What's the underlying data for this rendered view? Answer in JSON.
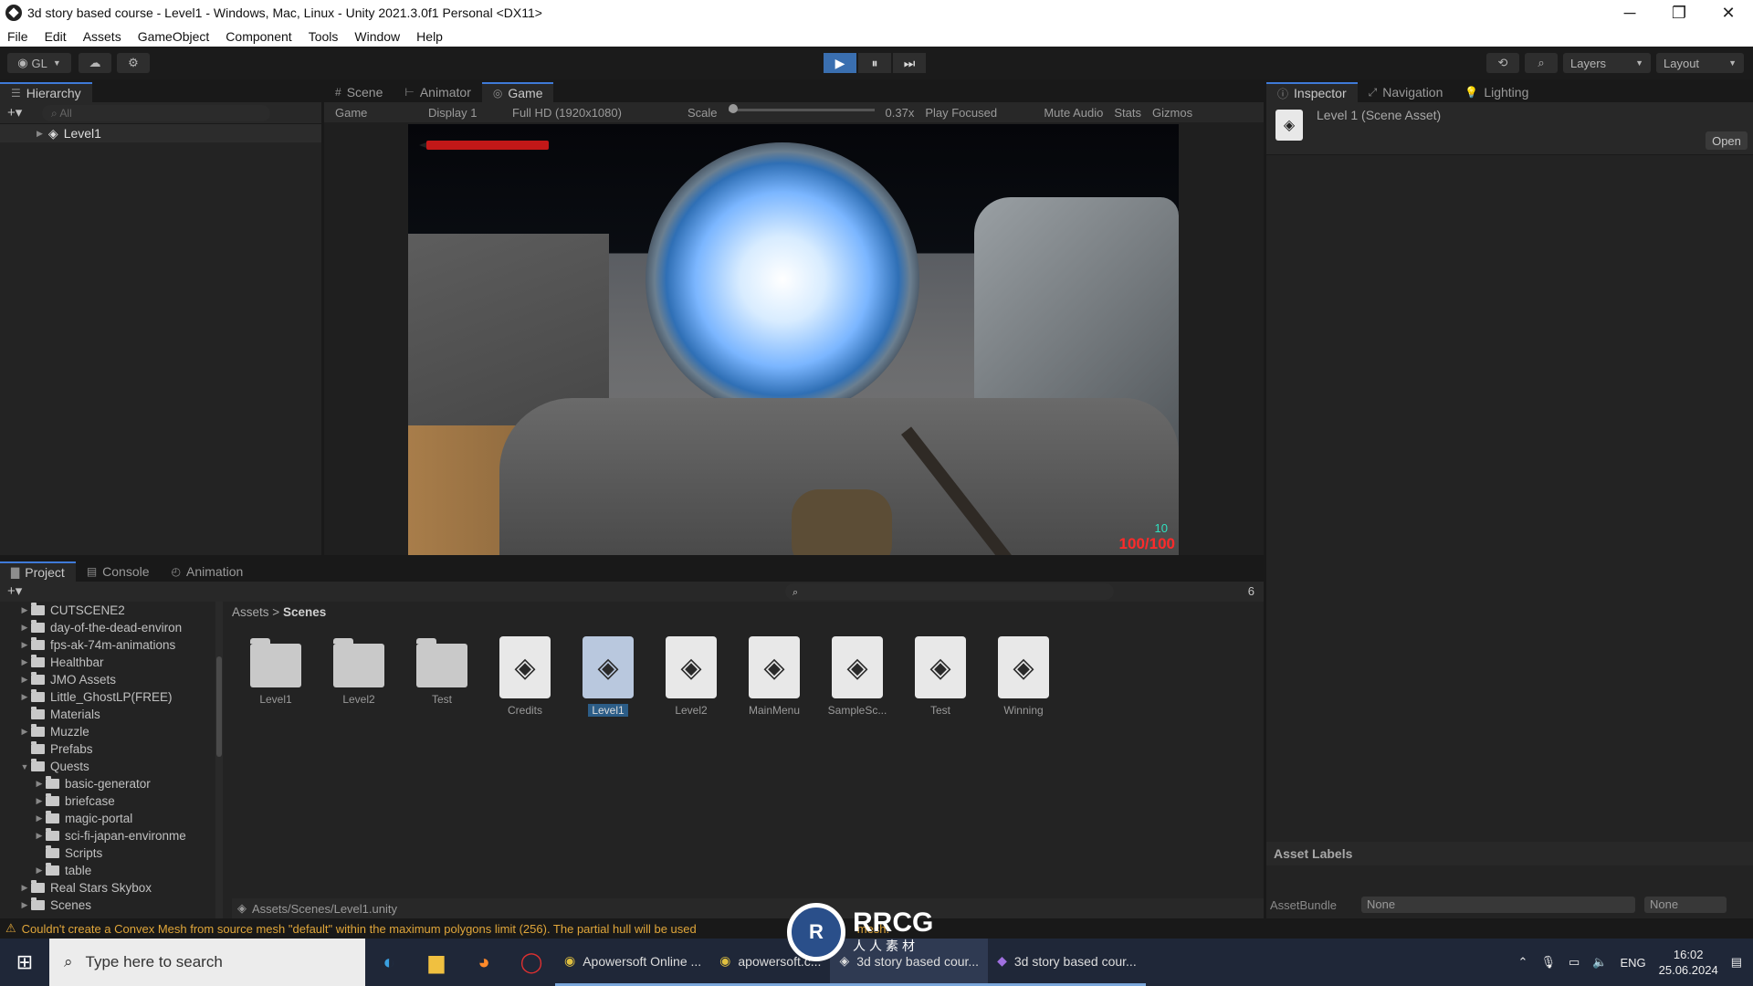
{
  "window": {
    "title": "3d story based course - Level1 - Windows, Mac, Linux - Unity 2021.3.0f1 Personal <DX11>",
    "minimize": "─",
    "restore": "❐",
    "close": "✕"
  },
  "menu": [
    "File",
    "Edit",
    "Assets",
    "GameObject",
    "Component",
    "Tools",
    "Window",
    "Help"
  ],
  "toolbar": {
    "account": "GL",
    "layers": "Layers",
    "layout": "Layout",
    "play": "▶",
    "pause": "⏸",
    "step": "⏭"
  },
  "hierarchy": {
    "tab": "Hierarchy",
    "search_placeholder": "All",
    "root": "Level1"
  },
  "gameview": {
    "tabs": [
      "Scene",
      "Animator",
      "Game"
    ],
    "toolbar": {
      "mode": "Game",
      "display": "Display 1",
      "resolution": "Full HD (1920x1080)",
      "scale_label": "Scale",
      "scale_value": "0.37x",
      "play_focused": "Play Focused",
      "mute": "Mute Audio",
      "stats": "Stats",
      "gizmos": "Gizmos"
    },
    "hud": {
      "ammo_clip": "10",
      "ammo_total": "100/100"
    }
  },
  "inspector": {
    "tabs": [
      "Inspector",
      "Navigation",
      "Lighting"
    ],
    "asset_title": "Level 1 (Scene Asset)",
    "open_button": "Open",
    "asset_labels": "Asset Labels",
    "asset_bundle_label": "AssetBundle",
    "asset_bundle_value": "None",
    "asset_variant_value": "None"
  },
  "project": {
    "tabs": [
      "Project",
      "Console",
      "Animation"
    ],
    "tree": [
      {
        "label": "CUTSCENE2",
        "indent": 0,
        "arrow": "▶",
        "open": false
      },
      {
        "label": "day-of-the-dead-environ",
        "indent": 0,
        "arrow": "▶",
        "open": false
      },
      {
        "label": "fps-ak-74m-animations",
        "indent": 0,
        "arrow": "▶",
        "open": false
      },
      {
        "label": "Healthbar",
        "indent": 0,
        "arrow": "▶",
        "open": false
      },
      {
        "label": "JMO Assets",
        "indent": 0,
        "arrow": "▶",
        "open": false
      },
      {
        "label": "Little_GhostLP(FREE)",
        "indent": 0,
        "arrow": "▶",
        "open": false
      },
      {
        "label": "Materials",
        "indent": 0,
        "arrow": "",
        "open": false
      },
      {
        "label": "Muzzle",
        "indent": 0,
        "arrow": "▶",
        "open": false
      },
      {
        "label": "Prefabs",
        "indent": 0,
        "arrow": "",
        "open": false
      },
      {
        "label": "Quests",
        "indent": 0,
        "arrow": "▼",
        "open": true
      },
      {
        "label": "basic-generator",
        "indent": 1,
        "arrow": "▶",
        "open": false
      },
      {
        "label": "briefcase",
        "indent": 1,
        "arrow": "▶",
        "open": false
      },
      {
        "label": "magic-portal",
        "indent": 1,
        "arrow": "▶",
        "open": false
      },
      {
        "label": "sci-fi-japan-environme",
        "indent": 1,
        "arrow": "▶",
        "open": false
      },
      {
        "label": "Scripts",
        "indent": 1,
        "arrow": "",
        "open": false
      },
      {
        "label": "table",
        "indent": 1,
        "arrow": "▶",
        "open": false
      },
      {
        "label": "Real Stars Skybox",
        "indent": 0,
        "arrow": "▶",
        "open": false
      },
      {
        "label": "Scenes",
        "indent": 0,
        "arrow": "▶",
        "open": false
      }
    ],
    "breadcrumb": {
      "root": "Assets",
      "sep": ">",
      "current": "Scenes"
    },
    "assets": [
      {
        "name": "Level1",
        "kind": "folder",
        "selected": false
      },
      {
        "name": "Level2",
        "kind": "folder",
        "selected": false
      },
      {
        "name": "Test",
        "kind": "folder",
        "selected": false
      },
      {
        "name": "Credits",
        "kind": "scene",
        "selected": false
      },
      {
        "name": "Level1",
        "kind": "scene",
        "selected": true
      },
      {
        "name": "Level2",
        "kind": "scene",
        "selected": false
      },
      {
        "name": "MainMenu",
        "kind": "scene",
        "selected": false
      },
      {
        "name": "SampleSc...",
        "kind": "scene",
        "selected": false
      },
      {
        "name": "Test",
        "kind": "scene",
        "selected": false
      },
      {
        "name": "Winning",
        "kind": "scene",
        "selected": false
      }
    ],
    "path": "Assets/Scenes/Level1.unity",
    "hidden_count": "6"
  },
  "status": {
    "message": "Couldn't create a Convex Mesh from source mesh \"default\" within the maximum polygons limit (256). The partial hull will be used",
    "tail": "mesh."
  },
  "taskbar": {
    "search_placeholder": "Type here to search",
    "apps": [
      "Apowersoft Online ...",
      "apowersoft.c...",
      "3d story based cour...",
      "3d story based cour..."
    ],
    "lang": "ENG",
    "time": "16:02",
    "date": "25.06.2024"
  },
  "watermark": {
    "brand": "RRCG",
    "sub": "人人素材"
  }
}
